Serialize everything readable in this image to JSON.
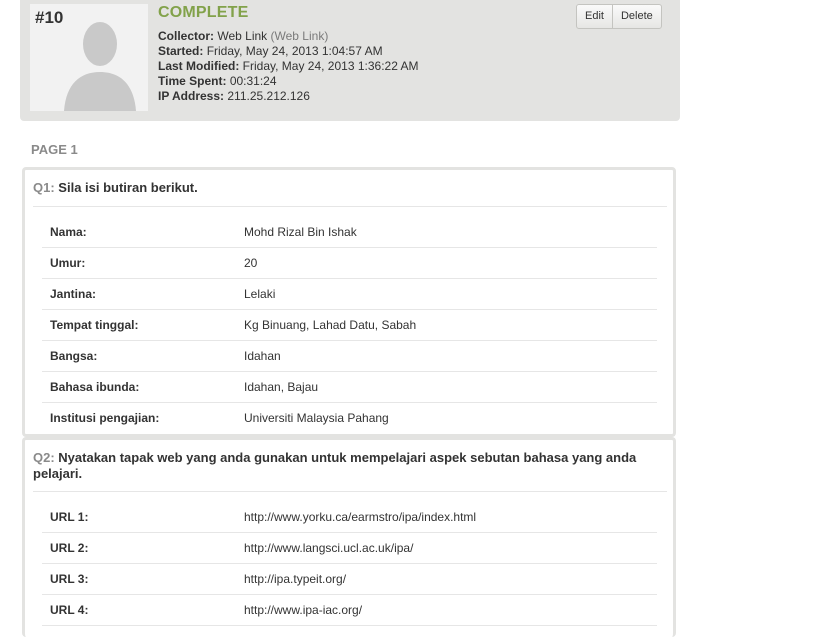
{
  "header": {
    "response_number": "#10",
    "status": "COMPLETE",
    "meta": [
      {
        "key": "Collector:",
        "value": "Web Link",
        "sub": "(Web Link)"
      },
      {
        "key": "Started:",
        "value": "Friday, May 24, 2013 1:04:57 AM"
      },
      {
        "key": "Last Modified:",
        "value": "Friday, May 24, 2013 1:36:22 AM"
      },
      {
        "key": "Time Spent:",
        "value": "00:31:24"
      },
      {
        "key": "IP Address:",
        "value": "211.25.212.126"
      }
    ],
    "buttons": {
      "edit": "Edit",
      "delete": "Delete"
    },
    "avatar_icon": "user-silhouette-icon"
  },
  "page_label": "PAGE 1",
  "questions": [
    {
      "number": "Q1:",
      "text": "Sila isi butiran berikut.",
      "answers": [
        {
          "label": "Nama:",
          "value": "Mohd Rizal Bin Ishak"
        },
        {
          "label": "Umur:",
          "value": "20"
        },
        {
          "label": "Jantina:",
          "value": "Lelaki"
        },
        {
          "label": "Tempat tinggal:",
          "value": "Kg Binuang, Lahad Datu, Sabah"
        },
        {
          "label": "Bangsa:",
          "value": "Idahan"
        },
        {
          "label": "Bahasa ibunda:",
          "value": "Idahan, Bajau"
        },
        {
          "label": "Institusi pengajian:",
          "value": "Universiti Malaysia Pahang"
        }
      ]
    },
    {
      "number": "Q2:",
      "text": "Nyatakan tapak web yang anda gunakan untuk mempelajari aspek sebutan bahasa yang anda pelajari.",
      "answers": [
        {
          "label": "URL 1:",
          "value": "http://www.yorku.ca/earmstro/ipa/index.html"
        },
        {
          "label": "URL 2:",
          "value": "http://www.langsci.ucl.ac.uk/ipa/"
        },
        {
          "label": "URL 3:",
          "value": "http://ipa.typeit.org/"
        },
        {
          "label": "URL 4:",
          "value": "http://www.ipa-iac.org/"
        }
      ]
    }
  ],
  "colors": {
    "status_green": "#82a24a",
    "panel_bg": "#e3e3e1",
    "muted": "#8a8a8a"
  }
}
